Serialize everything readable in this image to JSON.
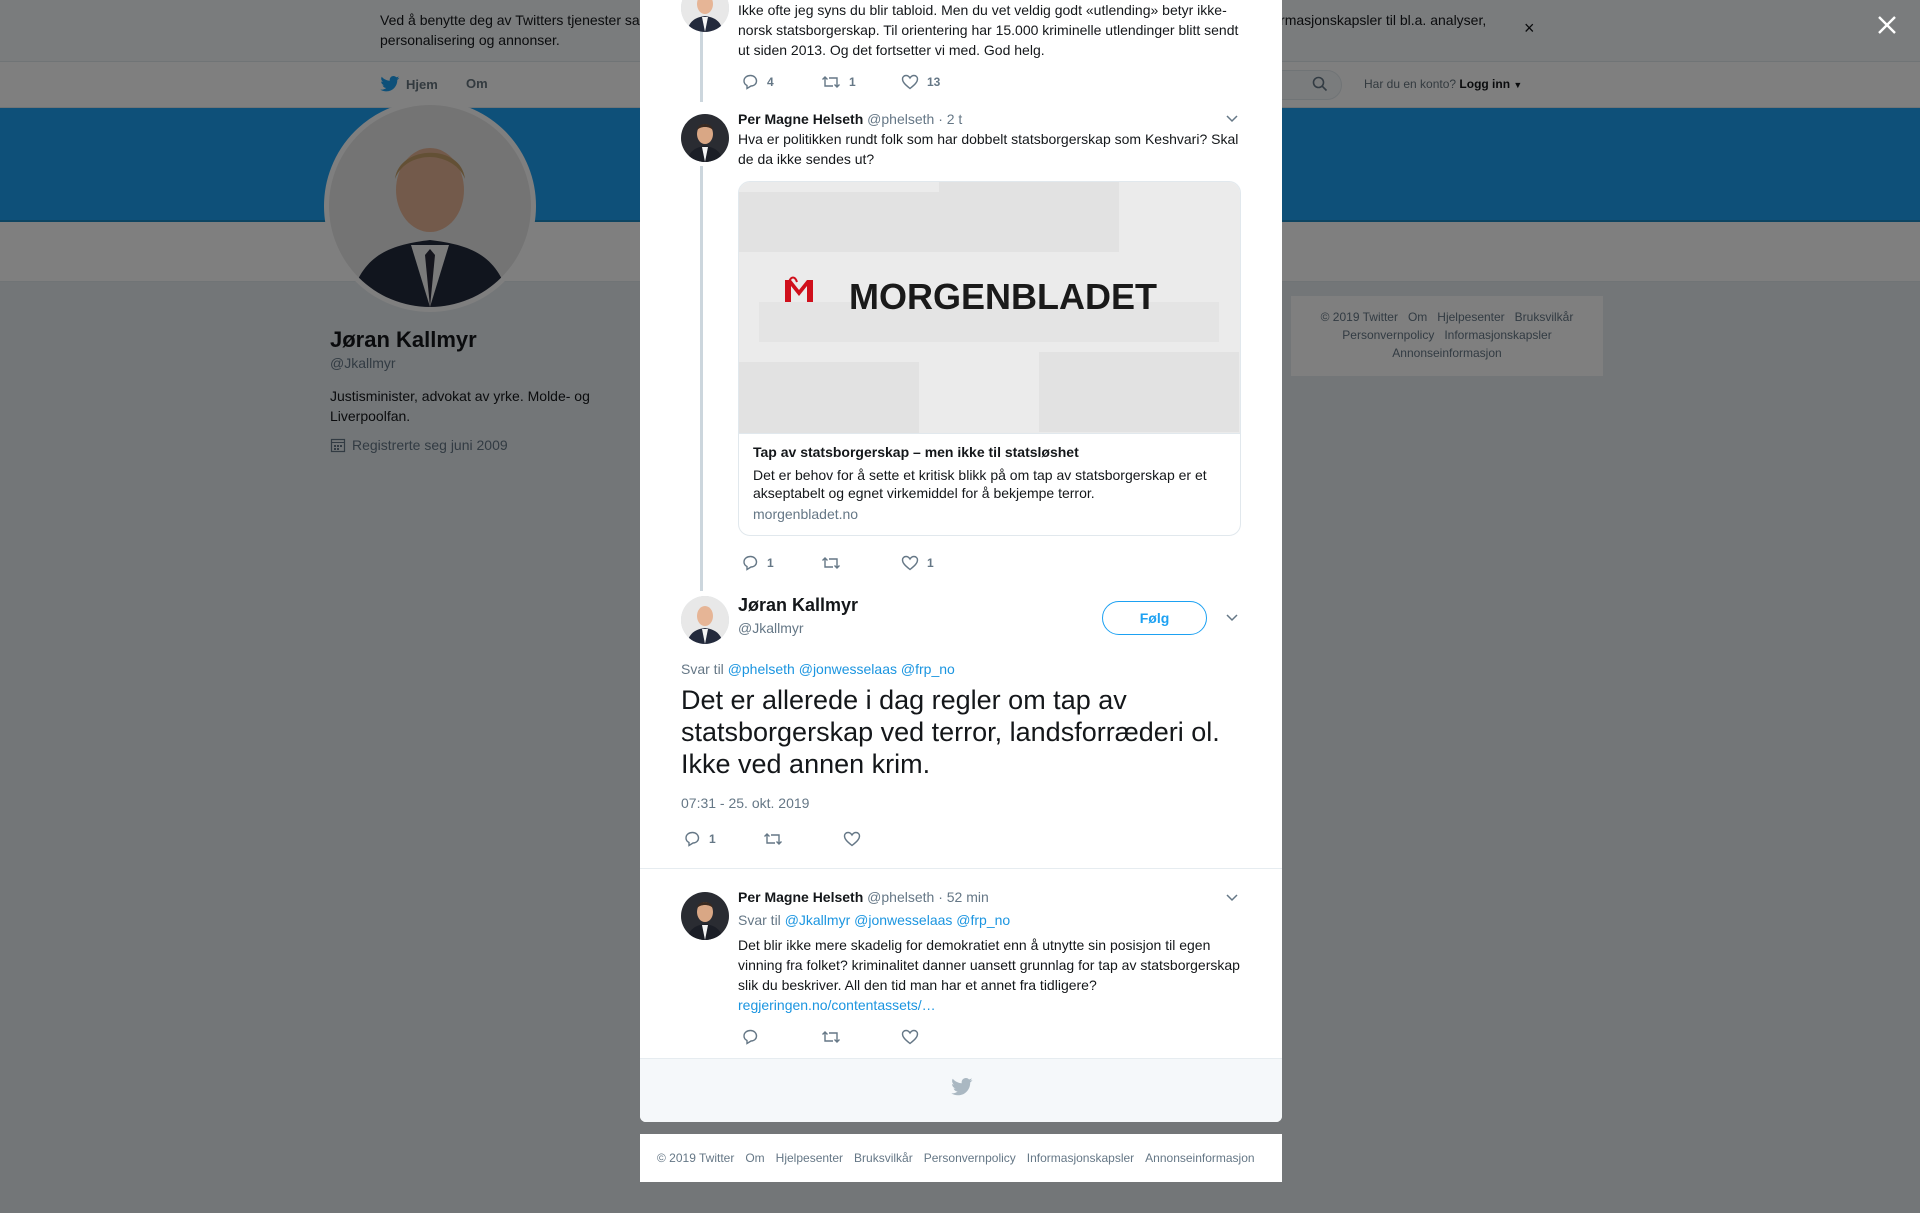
{
  "cookie_banner": {
    "text_left": "Ved å benytte deg av Twitters tjenester sa",
    "text_right": "informasjonskapsler til bl.a. analyser,",
    "text_line2": "personalisering og annonser."
  },
  "topnav": {
    "home": "Hjem",
    "about": "Om",
    "login_prompt": "Har du en konto?",
    "login": "Logg inn"
  },
  "profile": {
    "name": "Jøran Kallmyr",
    "handle": "@Jkallmyr",
    "bio": "Justisminister, advokat av yrke. Molde- og Liverpoolfan.",
    "joined": "Registrerte seg juni 2009"
  },
  "right_footer": [
    "© 2019 Twitter",
    "Om",
    "Hjelpesenter",
    "Bruksvilkår",
    "Personvernpolicy",
    "Informasjonskapsler",
    "Annonseinformasjon"
  ],
  "tweet1": {
    "text": "Ikke ofte jeg syns du blir tabloid. Men du vet veldig godt «utlending» betyr ikke-norsk statsborgerskap. Til orientering har 15.000 kriminelle utlendinger blitt sendt ut siden 2013. Og det fortsetter vi med. God helg.",
    "replies": "4",
    "retweets": "1",
    "likes": "13"
  },
  "tweet2": {
    "name": "Per Magne Helseth",
    "handle": "@phelseth",
    "time": "· 2 t",
    "text": "Hva er politikken rundt folk som har dobbelt statsborgerskap som Keshvari? Skal de da ikke sendes ut?",
    "card": {
      "logo_text": "MORGENBLADET",
      "title": "Tap av statsborgerskap – men ikke til statsløshet",
      "description": "Det er behov for å sette et kritisk blikk på om tap av statsborgerskap er et akseptabelt og egnet virkemiddel for å bekjempe terror.",
      "domain": "morgenbladet.no"
    },
    "replies": "1",
    "retweets": "",
    "likes": "1"
  },
  "main_tweet": {
    "name": "Jøran Kallmyr",
    "handle": "@Jkallmyr",
    "follow": "Følg",
    "reply_to_label": "Svar til",
    "reply_to": [
      "@phelseth",
      "@jonwesselaas",
      "@frp_no"
    ],
    "text": "Det er allerede i dag regler om tap av statsborgerskap ved terror, landsforræderi ol. Ikke ved annen krim.",
    "date": "07:31 - 25. okt. 2019",
    "replies": "1"
  },
  "tweet3": {
    "name": "Per Magne Helseth",
    "handle": "@phelseth",
    "time": "· 52 min",
    "reply_to_label": "Svar til",
    "reply_to": [
      "@Jkallmyr",
      "@jonwesselaas",
      "@frp_no"
    ],
    "text": "Det blir ikke mere skadelig for demokratiet enn å utnytte sin posisjon til egen vinning fra folket? kriminalitet danner uansett grunnlag for tap av statsborgerskap slik du beskriver. All den tid man har et annet fra tidligere?",
    "link": "regjeringen.no/contentassets/…"
  },
  "modal_footer": [
    "© 2019 Twitter",
    "Om",
    "Hjelpesenter",
    "Bruksvilkår",
    "Personvernpolicy",
    "Informasjonskapsler",
    "Annonseinformasjon"
  ],
  "colors": {
    "accent": "#1da1f2",
    "link": "#1b95e0",
    "muted": "#657786",
    "brand_red": "#d0101c"
  }
}
